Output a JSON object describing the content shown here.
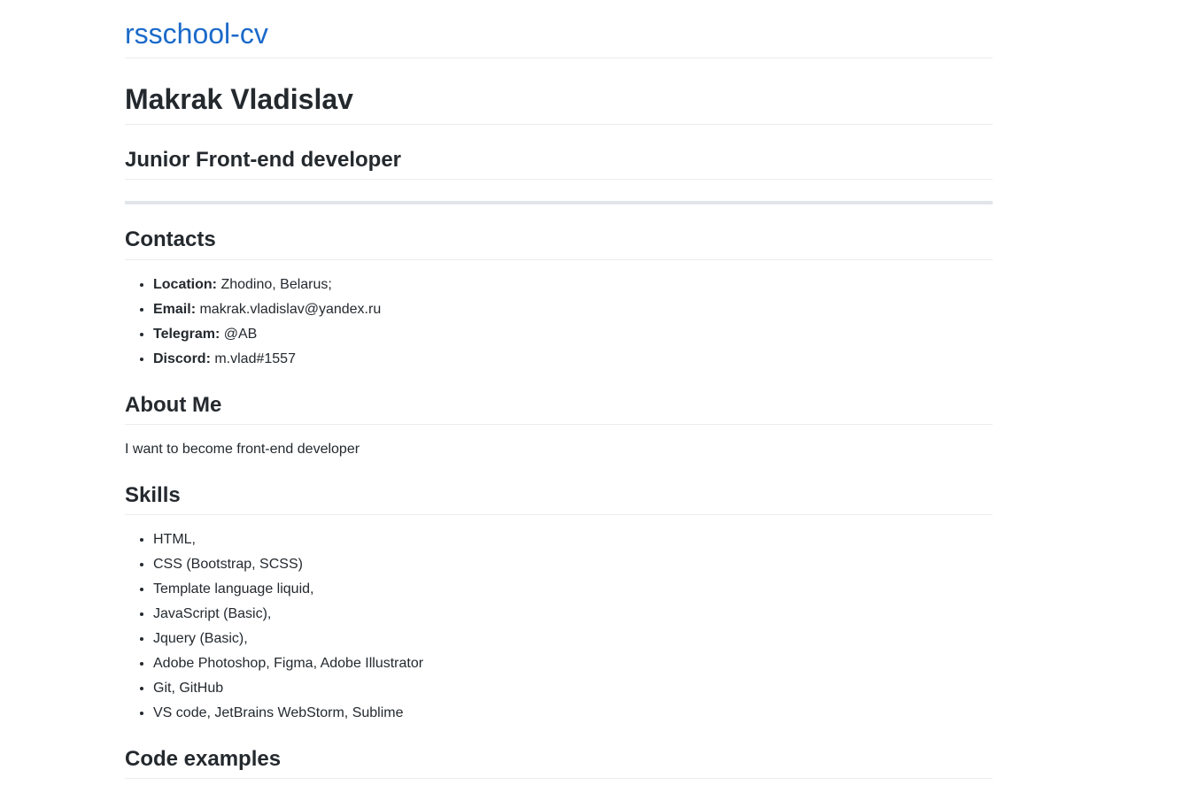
{
  "site": {
    "title": "rsschool-cv"
  },
  "name": "Makrak Vladislav",
  "position": "Junior Front-end developer",
  "contacts": {
    "heading": "Contacts",
    "items": [
      {
        "label": "Location:",
        "value": " Zhodino, Belarus;"
      },
      {
        "label": "Email:",
        "value": " makrak.vladislav@yandex.ru"
      },
      {
        "label": "Telegram:",
        "value": " @AB"
      },
      {
        "label": "Discord:",
        "value": " m.vlad#1557"
      }
    ]
  },
  "about": {
    "heading": "About Me",
    "text": "I want to become front-end developer"
  },
  "skills": {
    "heading": "Skills",
    "items": [
      "HTML,",
      "CSS (Bootstrap, SCSS)",
      "Template language liquid,",
      "JavaScript (Basic),",
      "Jquery (Basic),",
      "Adobe Photoshop, Figma, Adobe Illustrator",
      "Git, GitHub",
      "VS code, JetBrains WebStorm, Sublime"
    ]
  },
  "code": {
    "heading": "Code examples"
  },
  "colors": {
    "link": "#1b6ac9",
    "text": "#24292e",
    "rule": "#eaecef"
  }
}
